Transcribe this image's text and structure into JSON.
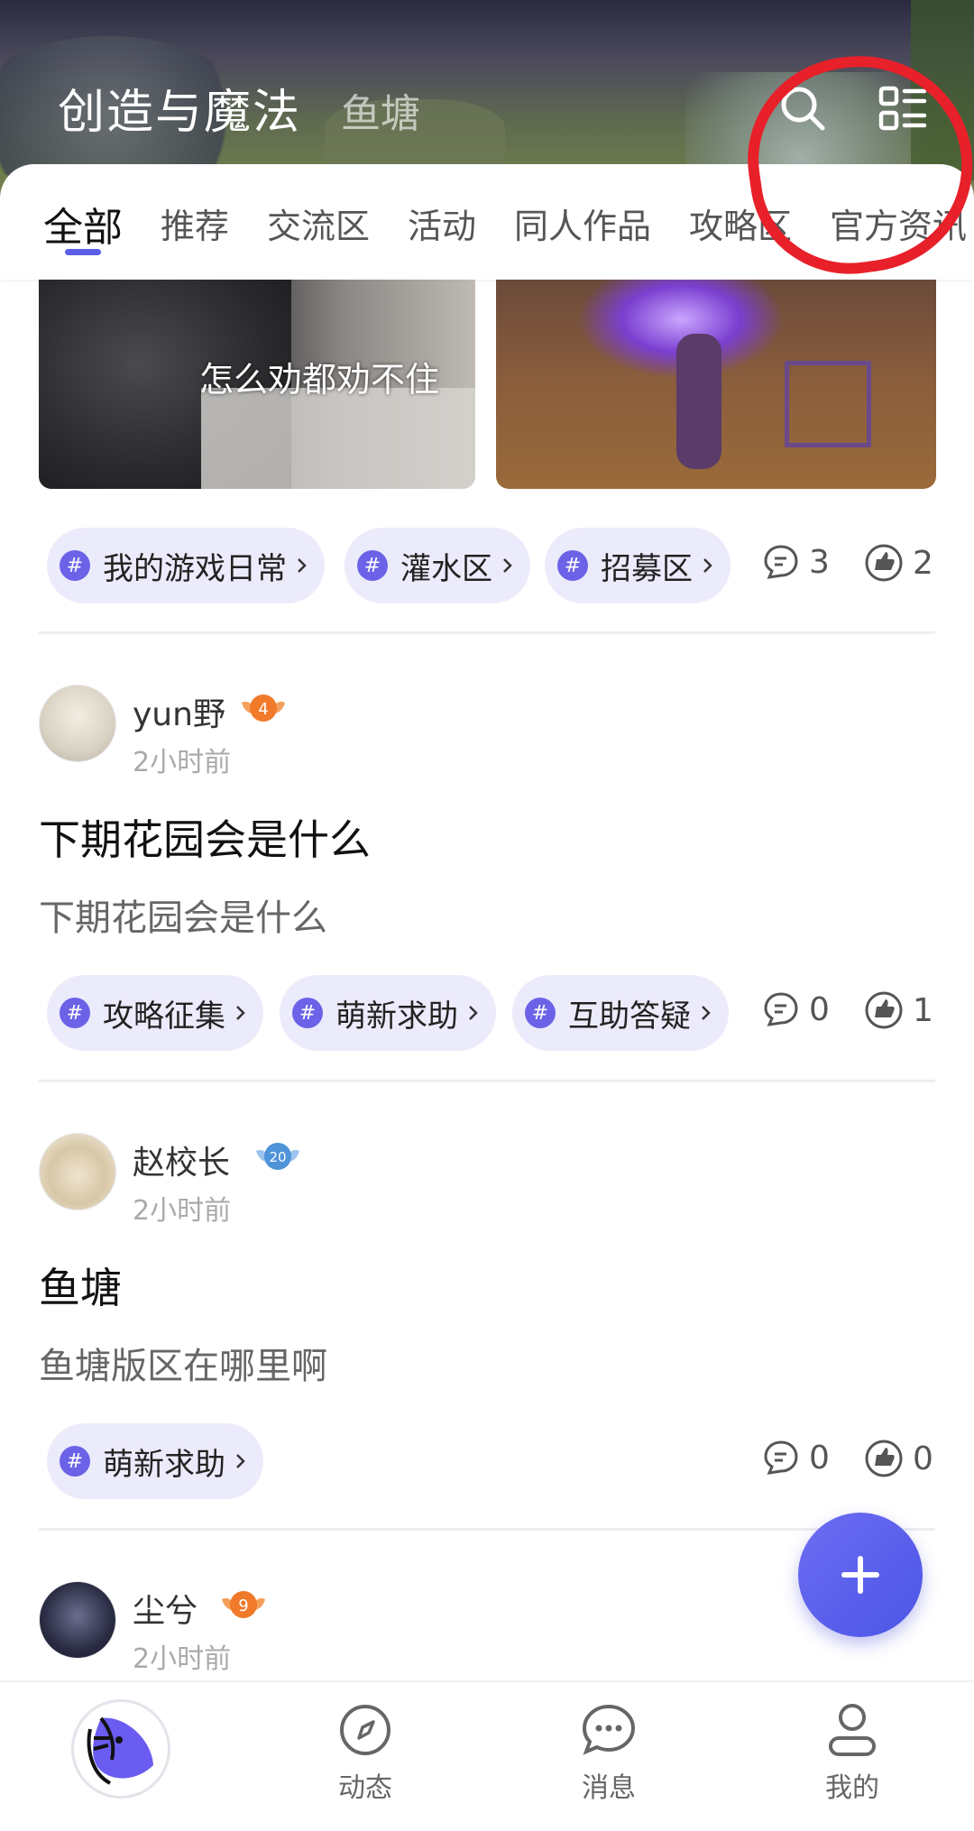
{
  "header": {
    "title": "创造与魔法",
    "subtitle": "鱼塘",
    "icons": [
      "search-icon",
      "menu-grid-icon"
    ]
  },
  "tabs": [
    {
      "label": "全部",
      "active": true
    },
    {
      "label": "推荐"
    },
    {
      "label": "交流区"
    },
    {
      "label": "活动"
    },
    {
      "label": "同人作品"
    },
    {
      "label": "攻略区"
    },
    {
      "label": "官方资讯"
    }
  ],
  "post0": {
    "image_caption": "怎么劝都劝不住",
    "tags": [
      "我的游戏日常",
      "灌水区",
      "招募区"
    ],
    "comments": "3",
    "likes": "2"
  },
  "posts": [
    {
      "user": "yun野",
      "level": "4",
      "time": "2小时前",
      "title": "下期花园会是什么",
      "body": "下期花园会是什么",
      "tags": [
        "攻略征集",
        "萌新求助",
        "互助答疑"
      ],
      "comments": "0",
      "likes": "1"
    },
    {
      "user": "赵校长",
      "level": "20",
      "time": "2小时前",
      "title": "鱼塘",
      "body": "鱼塘版区在哪里啊",
      "tags": [
        "萌新求助"
      ],
      "comments": "0",
      "likes": "0"
    },
    {
      "user": "尘兮",
      "level": "9",
      "time": "2小时前"
    }
  ],
  "bottom_nav": [
    {
      "label": "",
      "icon": "home-fish-icon"
    },
    {
      "label": "动态",
      "icon": "compass-icon"
    },
    {
      "label": "消息",
      "icon": "chat-bubble-icon"
    },
    {
      "label": "我的",
      "icon": "person-icon"
    }
  ],
  "colors": {
    "accent": "#5b5ee6",
    "chip_bg": "#ecebfb",
    "annotation_circle": "#e8202a"
  }
}
